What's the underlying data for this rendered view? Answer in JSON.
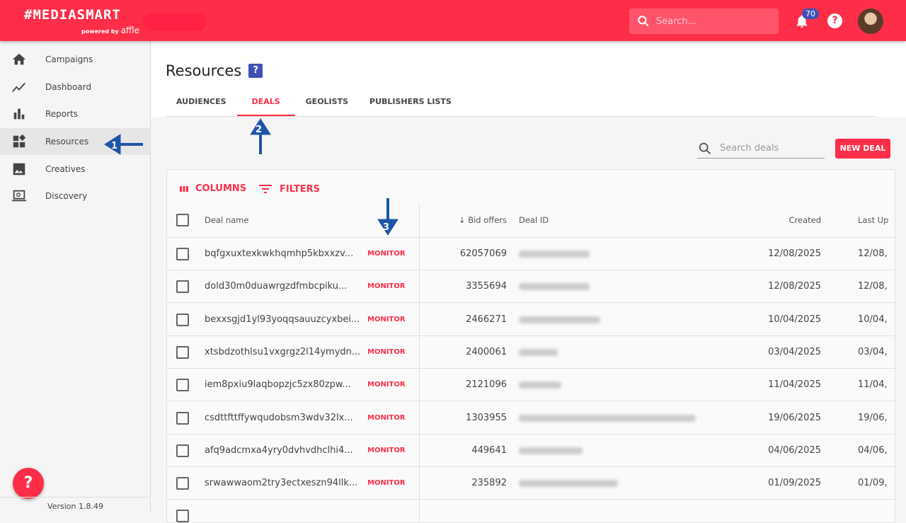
{
  "header": {
    "logo": "#MEDIASMART",
    "powered_by": "powered by",
    "powered_brand": "affle",
    "search_placeholder": "Search...",
    "notifications_count": "70",
    "help": "?"
  },
  "sidebar": {
    "items": [
      {
        "label": "Campaigns",
        "icon": "home-icon"
      },
      {
        "label": "Dashboard",
        "icon": "trend-icon"
      },
      {
        "label": "Reports",
        "icon": "bar-chart-icon"
      },
      {
        "label": "Resources",
        "icon": "widgets-icon",
        "active": true
      },
      {
        "label": "Creatives",
        "icon": "image-icon"
      },
      {
        "label": "Discovery",
        "icon": "laptop-search-icon"
      }
    ],
    "help_button": "?",
    "version": "Version 1.8.49"
  },
  "page": {
    "title": "Resources",
    "help_icon": "?",
    "tabs": [
      "AUDIENCES",
      "DEALS",
      "GEOLISTS",
      "PUBLISHERS LISTS"
    ],
    "active_tab": "DEALS",
    "search_placeholder": "Search deals",
    "new_deal": "NEW DEAL"
  },
  "grid": {
    "columns_label": "COLUMNS",
    "filters_label": "FILTERS",
    "headers": {
      "name": "Deal name",
      "bid": "Bid offers",
      "deal_id": "Deal ID",
      "created": "Created",
      "last": "Last Up"
    },
    "rows": [
      {
        "name": "bqfgxuxtexkwkhqmhp5kbxxzv...",
        "action": "MONITOR",
        "bid": "62057069",
        "created": "12/08/2025",
        "last": "12/08,"
      },
      {
        "name": "dold30m0duawrgzdfmbcpiku...",
        "action": "MONITOR",
        "bid": "3355694",
        "created": "12/08/2025",
        "last": "12/08,"
      },
      {
        "name": "bexxsgjd1yl93yoqqsauuzcyxbei...",
        "action": "MONITOR",
        "bid": "2466271",
        "created": "10/04/2025",
        "last": "10/04,"
      },
      {
        "name": "xtsbdzothlsu1vxgrgz2l14ymydn...",
        "action": "MONITOR",
        "bid": "2400061",
        "created": "03/04/2025",
        "last": "03/04,"
      },
      {
        "name": "iem8pxiu9laqbopzjc5zx80zpw...",
        "action": "MONITOR",
        "bid": "2121096",
        "created": "11/04/2025",
        "last": "11/04,"
      },
      {
        "name": "csdttfttffywqudobsm3wdv32lx...",
        "action": "MONITOR",
        "bid": "1303955",
        "created": "19/06/2025",
        "last": "19/06,"
      },
      {
        "name": "afq9adcmxa4yry0dvhvdhclhi4...",
        "action": "MONITOR",
        "bid": "449641",
        "created": "04/06/2025",
        "last": "04/06,"
      },
      {
        "name": "srwawwaom2try3ectxeszn94llk...",
        "action": "MONITOR",
        "bid": "235892",
        "created": "01/09/2025",
        "last": "01/09,"
      }
    ]
  },
  "annotations": [
    "1",
    "2",
    "3"
  ],
  "colors": {
    "brand": "#ff2e48",
    "accent": "#3f51b5",
    "annotation": "#1e55a8"
  }
}
